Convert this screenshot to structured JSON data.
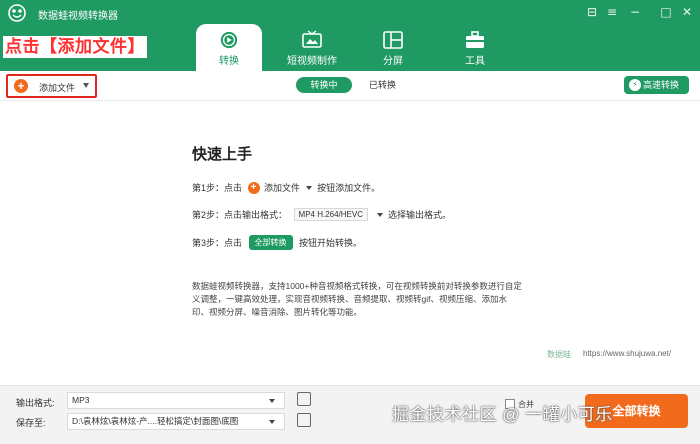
{
  "app": {
    "title": "数据蛙视频转换器"
  },
  "window_controls": {
    "feedback": "⊟",
    "menu": "≡",
    "minimize": "−",
    "maximize": "□",
    "close": "✕"
  },
  "annotation": "点击【添加文件】",
  "tabs": [
    {
      "label": "转换",
      "icon": "convert-icon",
      "active": true
    },
    {
      "label": "短视频制作",
      "icon": "tv-icon",
      "active": false
    },
    {
      "label": "分屏",
      "icon": "split-screen-icon",
      "active": false
    },
    {
      "label": "工具",
      "icon": "toolbox-icon",
      "active": false
    }
  ],
  "toolbar": {
    "add_file_label": "添加文件",
    "seg_converting": "转换中",
    "seg_converted": "已转换",
    "speed_label": "高速转换"
  },
  "quick_start": {
    "title": "快速上手",
    "step1_prefix": "第1步：点击",
    "step1_button": "添加文件",
    "step1_suffix": "按钮添加文件。",
    "step2_prefix": "第2步：点击输出格式：",
    "step2_format": "MP4 H.264/HEVC",
    "step2_suffix": "选择输出格式。",
    "step3_prefix": "第3步：点击",
    "step3_button": "全部转换",
    "step3_suffix": "按钮开始转换。",
    "description": "数据蛙视频转换器，支持1000+种音视频格式转换，可在视频转换前对转换参数进行自定义调整，一键高效处理，实现音视频转换、音频提取、视频转gif、视频压缩、添加水印、视频分屏、噪音消除、图片转化等功能。"
  },
  "watermark": {
    "brand": "数据蛙",
    "url": "https://www.shujuwa.net/"
  },
  "bottom": {
    "output_format_label": "输出格式:",
    "output_format_value": "MP3",
    "save_to_label": "保存至:",
    "save_to_value": "D:\\袁林炫\\袁林炫-产....轻松搞定\\封面图\\底图",
    "merge_label": "合并",
    "convert_all_label": "全部转换"
  },
  "site_watermark": "掘金技术社区 @ 一罐小可乐",
  "colors": {
    "brand_green": "#1f9a63",
    "accent_orange": "#f26b1d",
    "annotation_red": "#ff3030"
  }
}
